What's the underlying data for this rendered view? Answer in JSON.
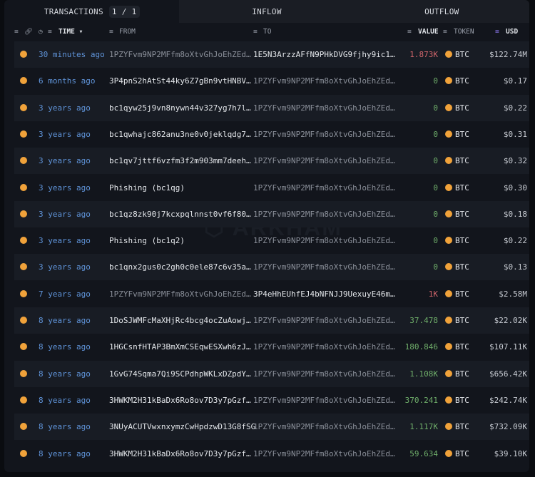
{
  "tabs": {
    "transactions": "TRANSACTIONS",
    "page": "1 / 1",
    "inflow": "INFLOW",
    "outflow": "OUTFLOW"
  },
  "columns": {
    "time": "TIME",
    "from": "FROM",
    "to": "TO",
    "value": "VALUE",
    "token": "TOKEN",
    "usd": "USD"
  },
  "watermark": "ARKHAM",
  "colors": {
    "negative": "#d0656b",
    "positive": "#6fae6a",
    "zero": "#6fae6a",
    "time": "#5f93d8",
    "coin": "#f0a23a"
  },
  "rows": [
    {
      "time": "30 minutes ago",
      "from": "1PZYFvm9NP2MFfm8oXtvGhJoEhZEd…",
      "to": "1E5N3ArzzAFfN9PHkDVG9fjhy9ic1…",
      "value": "1.873K",
      "dir": "out",
      "token": "BTC",
      "usd": "$122.74M",
      "own": "from"
    },
    {
      "time": "6 months ago",
      "from": "3P4pnS2hAtSt44ky6Z7gBn9vtHNBV…",
      "to": "1PZYFvm9NP2MFfm8oXtvGhJoEhZEd…",
      "value": "0",
      "dir": "in",
      "token": "BTC",
      "usd": "$0.17",
      "own": "to"
    },
    {
      "time": "3 years ago",
      "from": "bc1qyw25j9vn8nywn44v327yg7h7l…",
      "to": "1PZYFvm9NP2MFfm8oXtvGhJoEhZEd…",
      "value": "0",
      "dir": "in",
      "token": "BTC",
      "usd": "$0.22",
      "own": "to"
    },
    {
      "time": "3 years ago",
      "from": "bc1qwhajc862anu3ne0v0jeklqdg7…",
      "to": "1PZYFvm9NP2MFfm8oXtvGhJoEhZEd…",
      "value": "0",
      "dir": "in",
      "token": "BTC",
      "usd": "$0.31",
      "own": "to"
    },
    {
      "time": "3 years ago",
      "from": "bc1qv7jttf6vzfm3f2m903mm7deeh…",
      "to": "1PZYFvm9NP2MFfm8oXtvGhJoEhZEd…",
      "value": "0",
      "dir": "in",
      "token": "BTC",
      "usd": "$0.32",
      "own": "to"
    },
    {
      "time": "3 years ago",
      "from": "Phishing (bc1qg)",
      "to": "1PZYFvm9NP2MFfm8oXtvGhJoEhZEd…",
      "value": "0",
      "dir": "in",
      "token": "BTC",
      "usd": "$0.30",
      "own": "to"
    },
    {
      "time": "3 years ago",
      "from": "bc1qz8zk90j7kcxpqlnnst0vf6f80…",
      "to": "1PZYFvm9NP2MFfm8oXtvGhJoEhZEd…",
      "value": "0",
      "dir": "in",
      "token": "BTC",
      "usd": "$0.18",
      "own": "to"
    },
    {
      "time": "3 years ago",
      "from": "Phishing (bc1q2)",
      "to": "1PZYFvm9NP2MFfm8oXtvGhJoEhZEd…",
      "value": "0",
      "dir": "in",
      "token": "BTC",
      "usd": "$0.22",
      "own": "to"
    },
    {
      "time": "3 years ago",
      "from": "bc1qnx2gus0c2gh0c0ele87c6v35a…",
      "to": "1PZYFvm9NP2MFfm8oXtvGhJoEhZEd…",
      "value": "0",
      "dir": "in",
      "token": "BTC",
      "usd": "$0.13",
      "own": "to"
    },
    {
      "time": "7 years ago",
      "from": "1PZYFvm9NP2MFfm8oXtvGhJoEhZEd…",
      "to": "3P4eHhEUhfEJ4bNFNJJ9UexuyE46m…",
      "value": "1K",
      "dir": "out",
      "token": "BTC",
      "usd": "$2.58M",
      "own": "from"
    },
    {
      "time": "8 years ago",
      "from": "1DoSJWMFcMaXHjRc4bcg4ocZuAowj…",
      "to": "1PZYFvm9NP2MFfm8oXtvGhJoEhZEd…",
      "value": "37.478",
      "dir": "in",
      "token": "BTC",
      "usd": "$22.02K",
      "own": "to"
    },
    {
      "time": "8 years ago",
      "from": "1HGCsnfHTAP3BmXmCSEqwESXwh6zJ…",
      "to": "1PZYFvm9NP2MFfm8oXtvGhJoEhZEd…",
      "value": "180.846",
      "dir": "in",
      "token": "BTC",
      "usd": "$107.11K",
      "own": "to"
    },
    {
      "time": "8 years ago",
      "from": "1GvG74Sqma7Qi9SCPdhpWKLxDZpdY…",
      "to": "1PZYFvm9NP2MFfm8oXtvGhJoEhZEd…",
      "value": "1.108K",
      "dir": "in",
      "token": "BTC",
      "usd": "$656.42K",
      "own": "to"
    },
    {
      "time": "8 years ago",
      "from": "3HWKM2H31kBaDx6Ro8ov7D3y7pGzf…",
      "to": "1PZYFvm9NP2MFfm8oXtvGhJoEhZEd…",
      "value": "370.241",
      "dir": "in",
      "token": "BTC",
      "usd": "$242.74K",
      "own": "to"
    },
    {
      "time": "8 years ago",
      "from": "3NUyACUTVwxnxymzCwHpdzwD13G8fSG",
      "to": "1PZYFvm9NP2MFfm8oXtvGhJoEhZEd…",
      "value": "1.117K",
      "dir": "in",
      "token": "BTC",
      "usd": "$732.09K",
      "own": "to"
    },
    {
      "time": "8 years ago",
      "from": "3HWKM2H31kBaDx6Ro8ov7D3y7pGzf…",
      "to": "1PZYFvm9NP2MFfm8oXtvGhJoEhZEd…",
      "value": "59.634",
      "dir": "in",
      "token": "BTC",
      "usd": "$39.10K",
      "own": "to"
    }
  ]
}
